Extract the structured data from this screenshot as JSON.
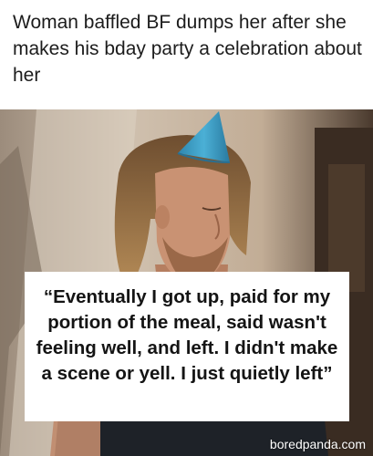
{
  "headline": "Woman baffled BF dumps her after she makes his bday party a celebration about her",
  "quote": "“Eventually I got up, paid for my portion of the meal, said wasn't feeling well, and left. I didn't make a scene or yell. I just quietly left”",
  "watermark": "boredpanda.com",
  "colors": {
    "party_hat": "#3b9ac0",
    "wall": "#c8b8a6",
    "shirt": "#1e2228",
    "hair": "#a0784a",
    "skin": "#c99273"
  }
}
